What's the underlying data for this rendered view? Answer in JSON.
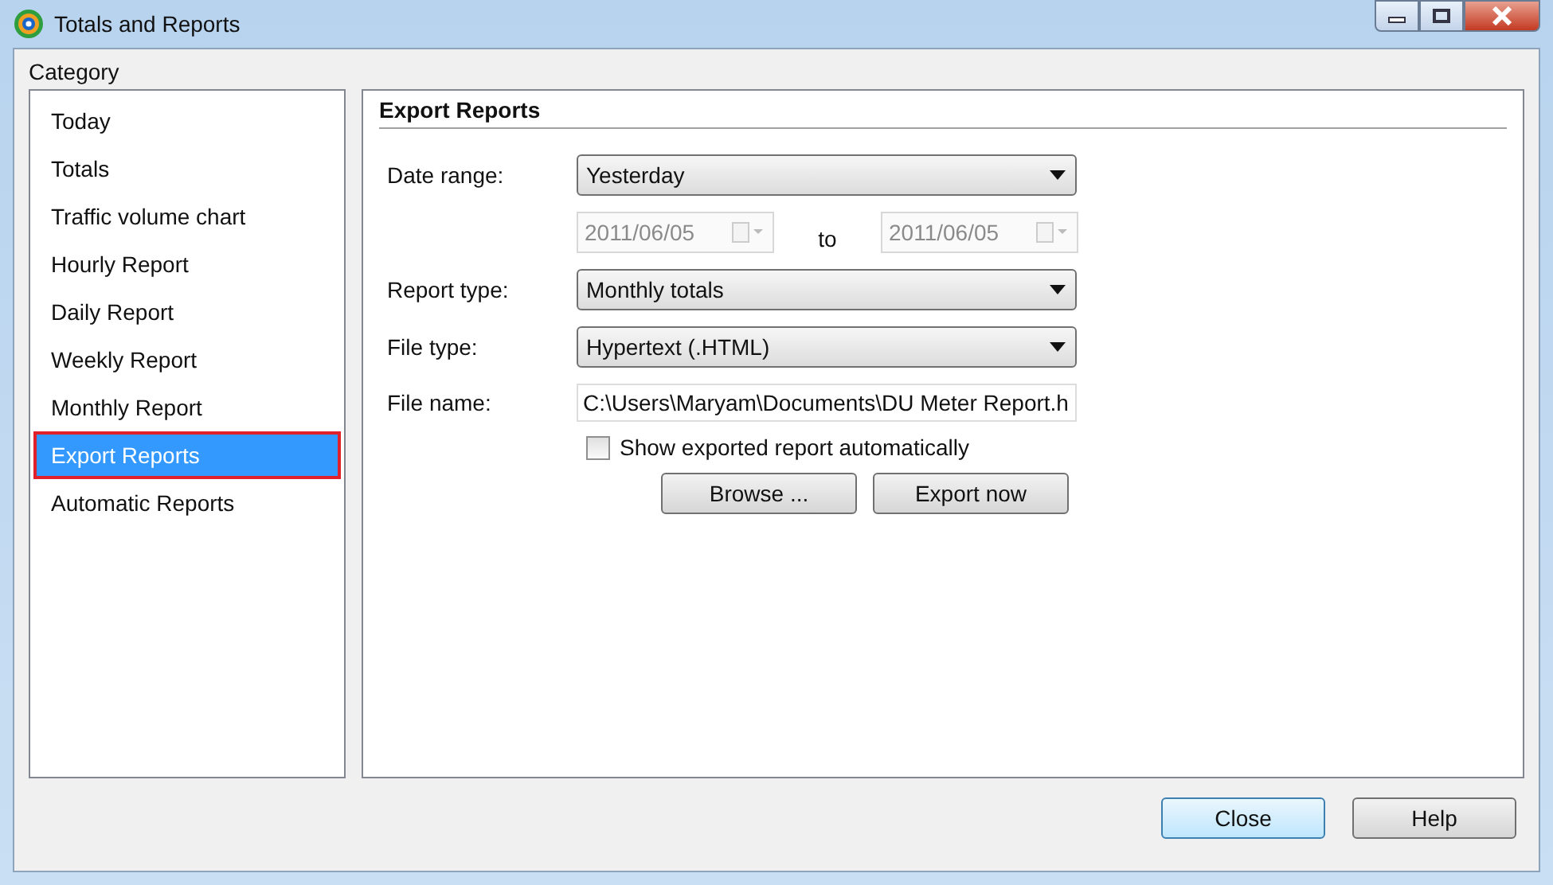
{
  "window": {
    "title": "Totals and Reports"
  },
  "category": {
    "label": "Category",
    "items": [
      {
        "label": "Today",
        "selected": false
      },
      {
        "label": "Totals",
        "selected": false
      },
      {
        "label": "Traffic volume chart",
        "selected": false
      },
      {
        "label": "Hourly Report",
        "selected": false
      },
      {
        "label": "Daily Report",
        "selected": false
      },
      {
        "label": "Weekly Report",
        "selected": false
      },
      {
        "label": "Monthly Report",
        "selected": false
      },
      {
        "label": "Export Reports",
        "selected": true
      },
      {
        "label": "Automatic Reports",
        "selected": false
      }
    ]
  },
  "panel": {
    "title": "Export Reports",
    "date_range": {
      "label": "Date range:",
      "value": "Yesterday",
      "from": "2011/06/05",
      "to_label": "to",
      "to": "2011/06/05",
      "dates_disabled": true
    },
    "report_type": {
      "label": "Report type:",
      "value": "Monthly totals"
    },
    "file_type": {
      "label": "File type:",
      "value": "Hypertext (.HTML)"
    },
    "file_name": {
      "label": "File name:",
      "value": "C:\\Users\\Maryam\\Documents\\DU Meter Report.h"
    },
    "show_automatically": {
      "label": "Show exported report automatically",
      "checked": false
    },
    "buttons": [
      "Browse ...",
      "Export now"
    ]
  },
  "footer_buttons": [
    {
      "label": "Close",
      "default": true
    },
    {
      "label": "Help",
      "default": false
    }
  ]
}
